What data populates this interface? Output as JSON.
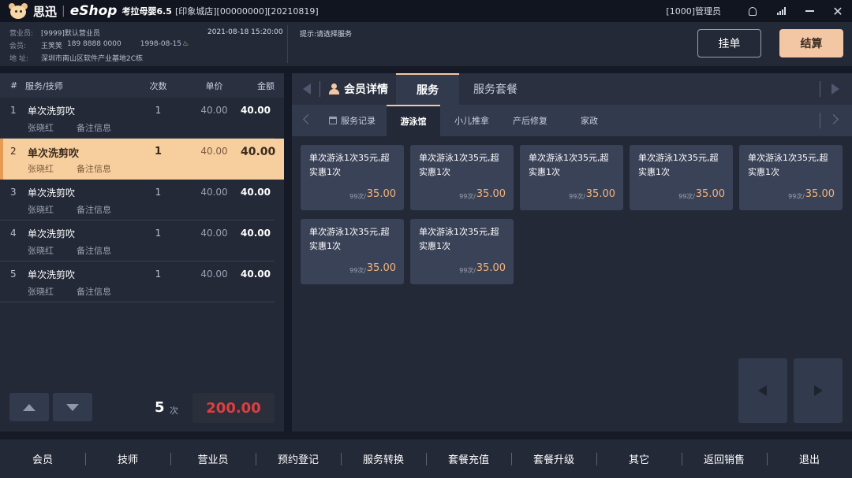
{
  "titlebar": {
    "brand": "思迅",
    "app": "eShop",
    "version": "考拉母婴6.5",
    "store": "[印象城店][00000000][20210819]",
    "admin": "[1000]管理员"
  },
  "info": {
    "operator_label": "营业员:",
    "operator": "[9999]默认营业员",
    "member_label": "会员:",
    "member_name": "王笑笑",
    "member_phone": "189 8888 0000",
    "member_birthday": "1998-08-15",
    "address_label": "地 址:",
    "address": "深圳市南山区软件产业基地2C栋",
    "datetime": "2021-08-18  15:20:00",
    "hint": "提示:请选择服务"
  },
  "actions": {
    "hold": "挂单",
    "pay": "结算"
  },
  "order": {
    "headers": {
      "idx": "#",
      "name": "服务/技师",
      "times": "次数",
      "price": "单价",
      "amount": "金额"
    },
    "rows": [
      {
        "idx": "1",
        "name": "单次洗剪吹",
        "times": "1",
        "price": "40.00",
        "amount": "40.00",
        "tech": "张晓红",
        "note": "备注信息"
      },
      {
        "idx": "2",
        "name": "单次洗剪吹",
        "times": "1",
        "price": "40.00",
        "amount": "40.00",
        "tech": "张晓红",
        "note": "备注信息"
      },
      {
        "idx": "3",
        "name": "单次洗剪吹",
        "times": "1",
        "price": "40.00",
        "amount": "40.00",
        "tech": "张晓红",
        "note": "备注信息"
      },
      {
        "idx": "4",
        "name": "单次洗剪吹",
        "times": "1",
        "price": "40.00",
        "amount": "40.00",
        "tech": "张晓红",
        "note": "备注信息"
      },
      {
        "idx": "5",
        "name": "单次洗剪吹",
        "times": "1",
        "price": "40.00",
        "amount": "40.00",
        "tech": "张晓红",
        "note": "备注信息"
      }
    ],
    "selected_index": 1,
    "count": "5",
    "count_unit": "次",
    "total": "200.00"
  },
  "tabs_main": {
    "member": "会员详情",
    "service": "服务",
    "package": "服务套餐"
  },
  "tabs_sub": {
    "records": "服务记录",
    "swim": "游泳馆",
    "massage": "小儿推拿",
    "postpartum": "产后修复",
    "housekeeping": "家政"
  },
  "cards": [
    {
      "title": "单次游泳1次35元,超实惠1次",
      "count": "99次/",
      "price": "35.00"
    },
    {
      "title": "单次游泳1次35元,超实惠1次",
      "count": "99次/",
      "price": "35.00"
    },
    {
      "title": "单次游泳1次35元,超实惠1次",
      "count": "99次/",
      "price": "35.00"
    },
    {
      "title": "单次游泳1次35元,超实惠1次",
      "count": "99次/",
      "price": "35.00"
    },
    {
      "title": "单次游泳1次35元,超实惠1次",
      "count": "99次/",
      "price": "35.00"
    },
    {
      "title": "单次游泳1次35元,超实惠1次",
      "count": "99次/",
      "price": "35.00"
    },
    {
      "title": "单次游泳1次35元,超实惠1次",
      "count": "99次/",
      "price": "35.00"
    }
  ],
  "bottom": [
    "会员",
    "技师",
    "营业员",
    "预约登记",
    "服务转换",
    "套餐充值",
    "套餐升级",
    "其它",
    "返回销售",
    "退出"
  ],
  "colors": {
    "accent": "#f3c7a4",
    "selected_row": "#f7cf9e",
    "total": "#e03e3e",
    "price": "#f3b37c"
  }
}
